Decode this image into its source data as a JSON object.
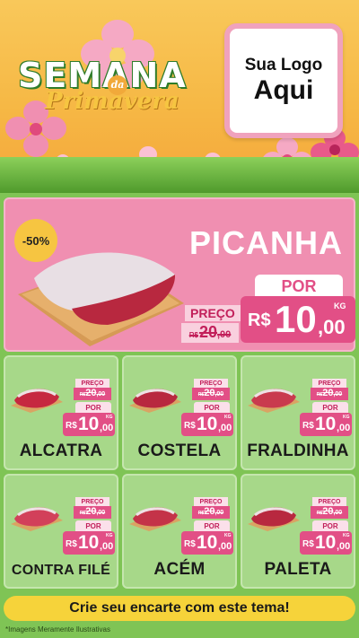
{
  "header": {
    "title_line1": "SEMANA",
    "title_connector": "da",
    "title_line2": "Primavera",
    "logo_line1": "Sua Logo",
    "logo_line2": "Aqui"
  },
  "featured": {
    "discount": "-50%",
    "name": "PICANHA",
    "preco_label": "PREÇO",
    "por_label": "POR",
    "old_price": {
      "currency": "R$",
      "int": "20",
      "dec": ",00"
    },
    "new_price": {
      "currency": "R$",
      "int": "10",
      "dec": ",00",
      "unit": "KG"
    }
  },
  "products": [
    {
      "name": "ALCATRA",
      "preco_label": "PREÇO",
      "por_label": "POR",
      "old_price": {
        "currency": "R$",
        "int": "20",
        "dec": ",00"
      },
      "new_price": {
        "currency": "R$",
        "int": "10",
        "dec": ",00",
        "unit": "KG"
      }
    },
    {
      "name": "COSTELA",
      "preco_label": "PREÇO",
      "por_label": "POR",
      "old_price": {
        "currency": "R$",
        "int": "20",
        "dec": ",00"
      },
      "new_price": {
        "currency": "R$",
        "int": "10",
        "dec": ",00",
        "unit": "KG"
      }
    },
    {
      "name": "FRALDINHA",
      "preco_label": "PREÇO",
      "por_label": "POR",
      "old_price": {
        "currency": "R$",
        "int": "20",
        "dec": ",00"
      },
      "new_price": {
        "currency": "R$",
        "int": "10",
        "dec": ",00",
        "unit": "KG"
      }
    },
    {
      "name": "CONTRA FILÉ",
      "preco_label": "PREÇO",
      "por_label": "POR",
      "old_price": {
        "currency": "R$",
        "int": "20",
        "dec": ",00"
      },
      "new_price": {
        "currency": "R$",
        "int": "10",
        "dec": ",00",
        "unit": "KG"
      }
    },
    {
      "name": "ACÉM",
      "preco_label": "PREÇO",
      "por_label": "POR",
      "old_price": {
        "currency": "R$",
        "int": "20",
        "dec": ",00"
      },
      "new_price": {
        "currency": "R$",
        "int": "10",
        "dec": ",00",
        "unit": "KG"
      }
    },
    {
      "name": "PALETA",
      "preco_label": "PREÇO",
      "por_label": "POR",
      "old_price": {
        "currency": "R$",
        "int": "20",
        "dec": ",00"
      },
      "new_price": {
        "currency": "R$",
        "int": "10",
        "dec": ",00",
        "unit": "KG"
      }
    }
  ],
  "footer": {
    "cta": "Crie seu encarte com este tema!",
    "disclaimer": "*Imagens Meramente Ilustrativas"
  },
  "colors": {
    "header_bg": "#f6b845",
    "featured_bg": "#f08fb1",
    "price_pink": "#e24f86",
    "card_green": "#a7d889",
    "cta_yellow": "#f6d33a",
    "badge_yellow": "#f6c541"
  },
  "icons": [
    "flower-icon",
    "meat-icon"
  ]
}
